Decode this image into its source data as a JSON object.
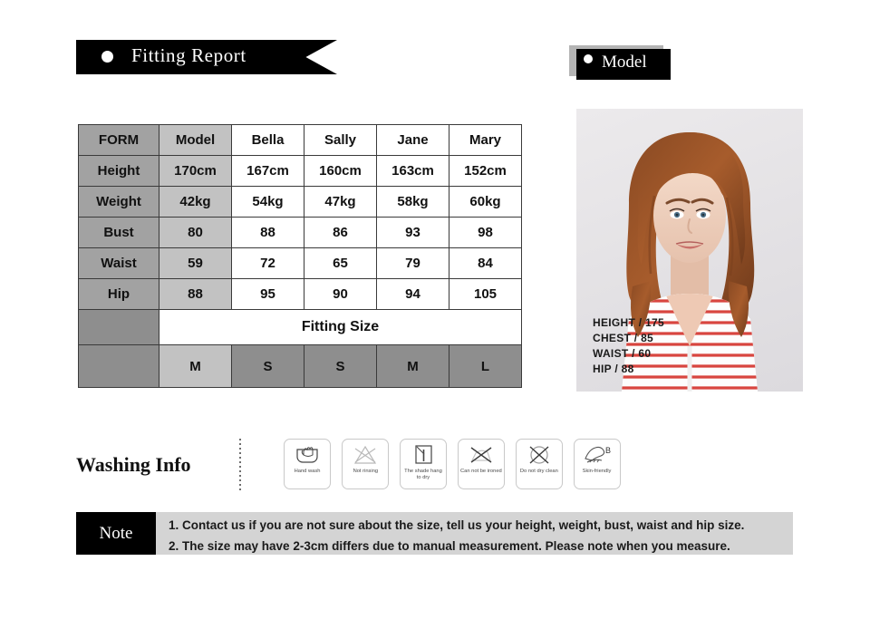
{
  "banners": {
    "fitting_report": "Fitting Report",
    "model": "Model"
  },
  "table": {
    "columns": [
      "FORM",
      "Model",
      "Bella",
      "Sally",
      "Jane",
      "Mary"
    ],
    "rows": [
      {
        "label": "Height",
        "values": [
          "170cm",
          "167cm",
          "160cm",
          "163cm",
          "152cm"
        ]
      },
      {
        "label": "Weight",
        "values": [
          "42kg",
          "54kg",
          "47kg",
          "58kg",
          "60kg"
        ]
      },
      {
        "label": "Bust",
        "values": [
          "80",
          "88",
          "86",
          "93",
          "98"
        ]
      },
      {
        "label": "Waist",
        "values": [
          "59",
          "72",
          "65",
          "79",
          "84"
        ]
      },
      {
        "label": "Hip",
        "values": [
          "88",
          "95",
          "90",
          "94",
          "105"
        ]
      }
    ],
    "fitting_size_label": "Fitting Size",
    "fitting_sizes": [
      "M",
      "S",
      "S",
      "M",
      "L"
    ]
  },
  "model_photo": {
    "stats": [
      "HEIGHT /  175",
      "CHEST /  85",
      "WAIST /  60",
      "HIP /  88"
    ]
  },
  "washing": {
    "title": "Washing Info",
    "icons": [
      {
        "name": "hand-wash-icon",
        "caption": "Hand wash"
      },
      {
        "name": "not-rinsing-icon",
        "caption": "Not rinsing"
      },
      {
        "name": "shade-hang-dry-icon",
        "caption": "The shade hang to dry"
      },
      {
        "name": "do-not-iron-icon",
        "caption": "Can not be ironed"
      },
      {
        "name": "do-not-dry-clean-icon",
        "caption": "Do not dry clean"
      },
      {
        "name": "skin-friendly-icon",
        "caption": "Skin-friendly"
      }
    ],
    "skin_friendly_mark": "B"
  },
  "note": {
    "label": "Note",
    "line1": "1. Contact us if you are not sure about the size, tell us your height, weight, bust, waist and hip size.",
    "line2": "2. The size may have 2-3cm differs due to manual measurement. Please note when you measure."
  },
  "colors": {
    "banner_black": "#000000",
    "table_header_gray": "#a2a2a2",
    "table_model_gray": "#c2c2c2",
    "table_size_gray": "#8e8e8e",
    "note_gray": "#d4d4d4",
    "stripe_red": "#d8453f"
  }
}
